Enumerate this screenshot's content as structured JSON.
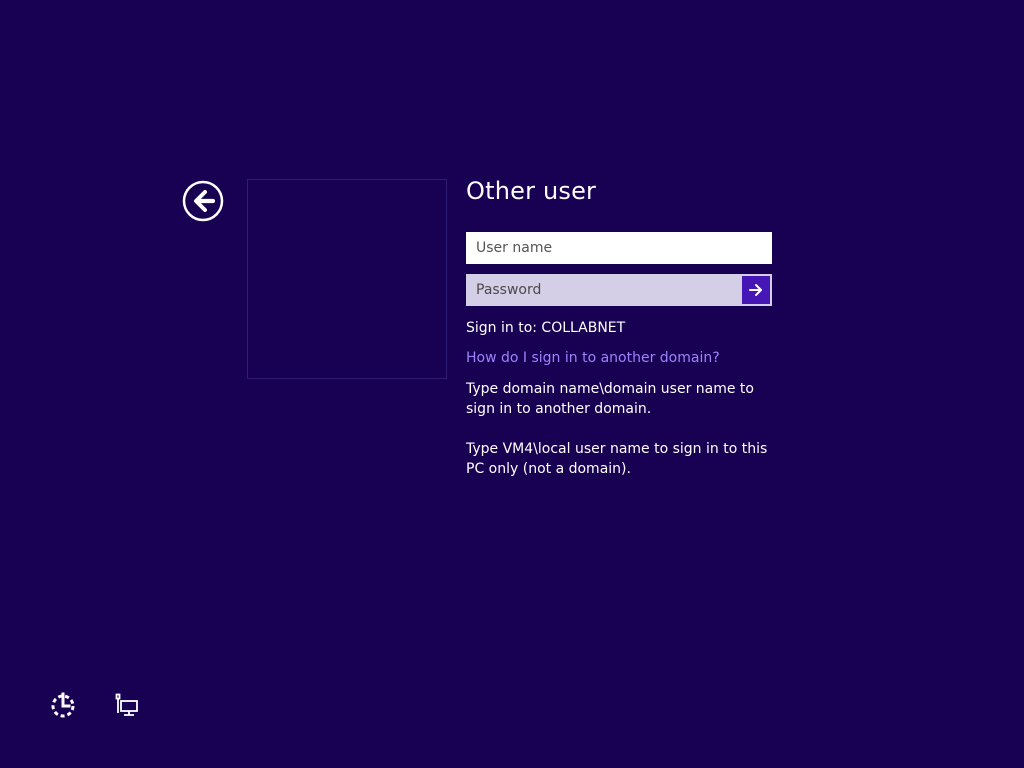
{
  "screen": {
    "background_color": "#180052",
    "accent_color": "#4617b4",
    "link_color": "#9b84ff"
  },
  "header": {
    "title": "Other user"
  },
  "form": {
    "username_placeholder": "User name",
    "password_placeholder": "Password",
    "sign_in_to": "Sign in to: COLLABNET",
    "help_link": "How do I sign in to another domain?",
    "help_text_1": "Type domain name\\domain user name to sign in to another domain.",
    "help_text_2": "Type VM4\\local user name to sign in to this PC only (not a domain)."
  },
  "icons": {
    "back": "back-arrow-circle-icon",
    "submit": "arrow-right-icon",
    "ease_of_access": "ease-of-access-icon",
    "network": "network-icon"
  }
}
